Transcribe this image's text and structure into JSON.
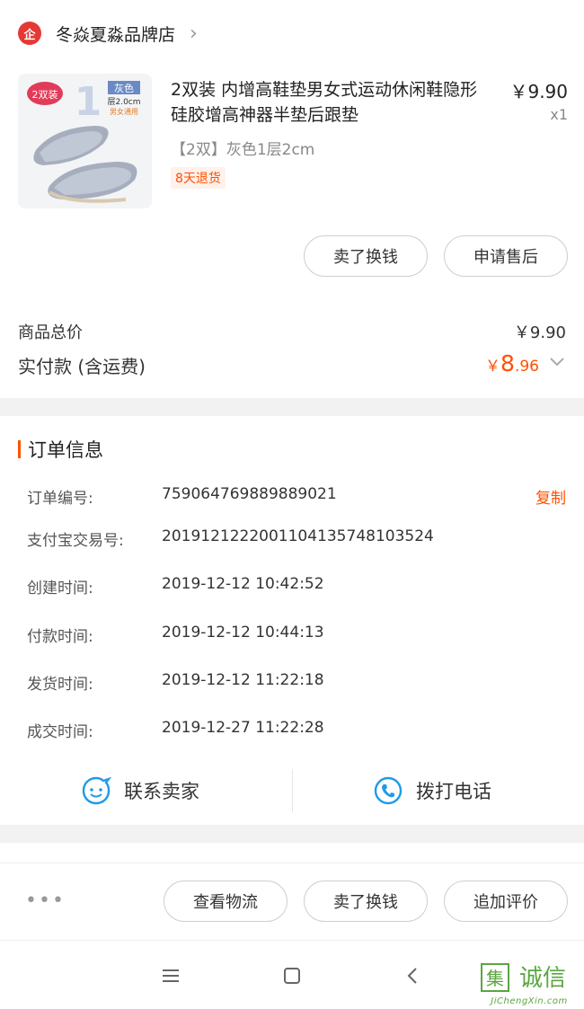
{
  "shop": {
    "logo_char": "企",
    "name": "冬焱夏淼品牌店",
    "chevron": "›"
  },
  "product": {
    "image_badge": "2双装",
    "image_number": "1",
    "image_color": "灰色",
    "image_spec": "层2.0cm",
    "image_note": "男女通用",
    "title": "2双装  内增高鞋垫男女式运动休闲鞋隐形硅胶增高神器半垫后跟垫",
    "price": "￥9.90",
    "quantity": "x1",
    "sku": "【2双】灰色1层2cm",
    "return_tag": "8天退货"
  },
  "item_actions": {
    "sell_exchange": "卖了换钱",
    "after_sale": "申请售后"
  },
  "summary": {
    "goods_total_label": "商品总价",
    "goods_total_value": "￥9.90",
    "paid_label": "实付款 (含运费)",
    "paid_currency": "￥",
    "paid_int": "8",
    "paid_dec": ".96"
  },
  "order_info": {
    "title": "订单信息",
    "copy_label": "复制",
    "rows": [
      {
        "label": "订单编号:",
        "value": "759064769889889021"
      },
      {
        "label": "支付宝交易号:",
        "value": "2019121222001104135748103524"
      },
      {
        "label": "创建时间:",
        "value": "2019-12-12 10:42:52"
      },
      {
        "label": "付款时间:",
        "value": "2019-12-12 10:44:13"
      },
      {
        "label": "发货时间:",
        "value": "2019-12-12 11:22:18"
      },
      {
        "label": "成交时间:",
        "value": "2019-12-27 11:22:28"
      }
    ]
  },
  "contact": {
    "seller": "联系卖家",
    "call": "拨打电话"
  },
  "bottom_actions": {
    "more": "•••",
    "logistics": "查看物流",
    "sell_exchange": "卖了换钱",
    "add_review": "追加评价"
  },
  "watermark": {
    "chars": "集诚信",
    "domain": "JiChengXin.com"
  },
  "colors": {
    "accent": "#ff5000",
    "icon_blue": "#1e9be8",
    "brand_red": "#e53935"
  }
}
